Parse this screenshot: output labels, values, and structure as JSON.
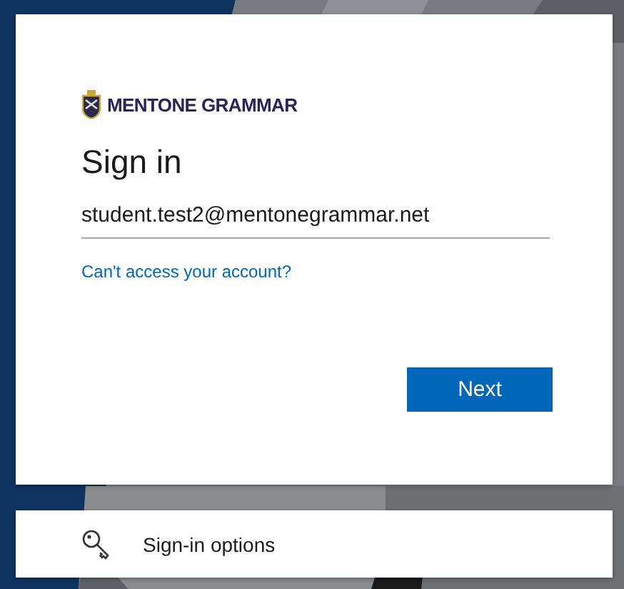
{
  "brand": {
    "name": "MENTONE GRAMMAR"
  },
  "title": "Sign in",
  "email_field": {
    "value": "student.test2@mentonegrammar.net"
  },
  "help_link": "Can't access your account?",
  "buttons": [
    "Next"
  ],
  "options": {
    "label": "Sign-in options"
  }
}
